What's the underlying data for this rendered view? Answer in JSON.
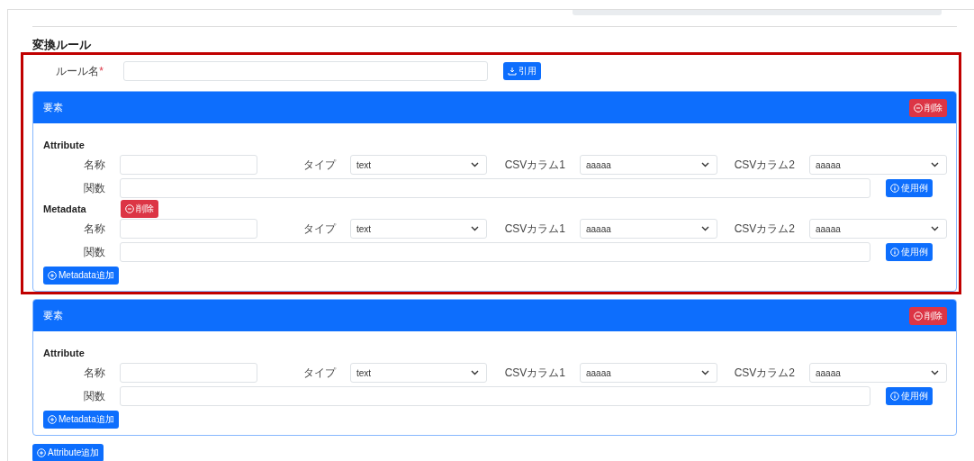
{
  "section_title": "変換ルール",
  "rule_name": {
    "label": "ルール名",
    "required_mark": "*",
    "button": "引用"
  },
  "elements": [
    {
      "title": "要素",
      "delete_button": "削除",
      "highlighted": true,
      "add_metadata_button": "Metadata追加",
      "groups": [
        {
          "kind": "attribute",
          "heading": "Attribute",
          "name_label": "名称",
          "type_label": "タイプ",
          "type_value": "text",
          "csv1_label": "CSVカラム1",
          "csv1_value": "aaaaa",
          "csv2_label": "CSVカラム2",
          "csv2_value": "aaaaa",
          "function_label": "関数",
          "example_button": "使用例"
        },
        {
          "kind": "metadata",
          "heading": "Metadata",
          "delete_button": "削除",
          "name_label": "名称",
          "type_label": "タイプ",
          "type_value": "text",
          "csv1_label": "CSVカラム1",
          "csv1_value": "aaaaa",
          "csv2_label": "CSVカラム2",
          "csv2_value": "aaaaa",
          "function_label": "関数",
          "example_button": "使用例"
        }
      ]
    },
    {
      "title": "要素",
      "delete_button": "削除",
      "highlighted": false,
      "add_metadata_button": "Metadata追加",
      "groups": [
        {
          "kind": "attribute",
          "heading": "Attribute",
          "name_label": "名称",
          "type_label": "タイプ",
          "type_value": "text",
          "csv1_label": "CSVカラム1",
          "csv1_value": "aaaaa",
          "csv2_label": "CSVカラム2",
          "csv2_value": "aaaaa",
          "function_label": "関数",
          "example_button": "使用例"
        }
      ]
    }
  ],
  "add_attribute_button": "Attribute追加"
}
